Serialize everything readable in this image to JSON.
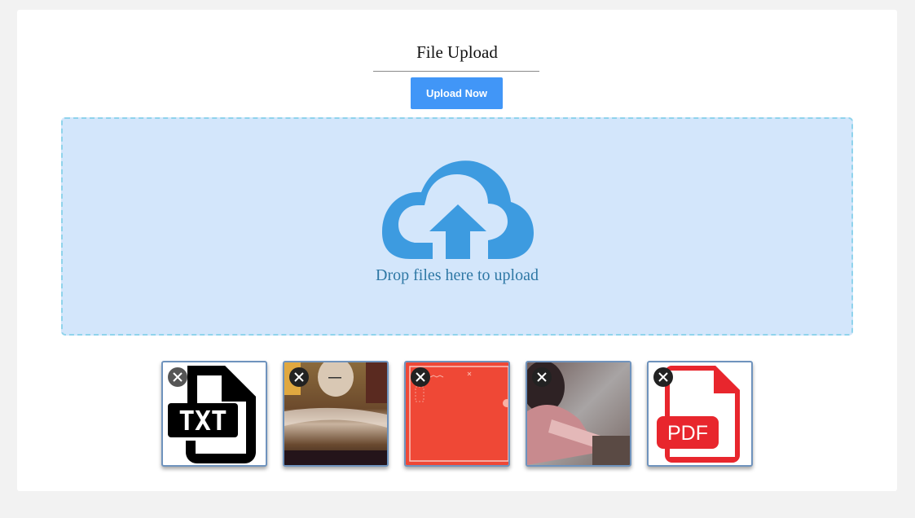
{
  "header": {
    "title": "File Upload",
    "upload_button_label": "Upload Now"
  },
  "dropzone": {
    "message": "Drop files here to upload",
    "icon": "cloud-upload-icon"
  },
  "files": [
    {
      "kind": "txt",
      "label": "TXT",
      "icon": "txt-file-icon"
    },
    {
      "kind": "image",
      "icon": "photo-thumbnail"
    },
    {
      "kind": "image",
      "icon": "photo-thumbnail"
    },
    {
      "kind": "image",
      "icon": "photo-thumbnail"
    },
    {
      "kind": "pdf",
      "label": "PDF",
      "icon": "pdf-file-icon"
    }
  ],
  "colors": {
    "accent": "#4196f7",
    "dropzone_bg": "#d3e6fb",
    "dropzone_border": "#8fd3ec",
    "cloud": "#3d9be0",
    "drop_text": "#2f78a5",
    "pdf_red": "#e8262d"
  }
}
